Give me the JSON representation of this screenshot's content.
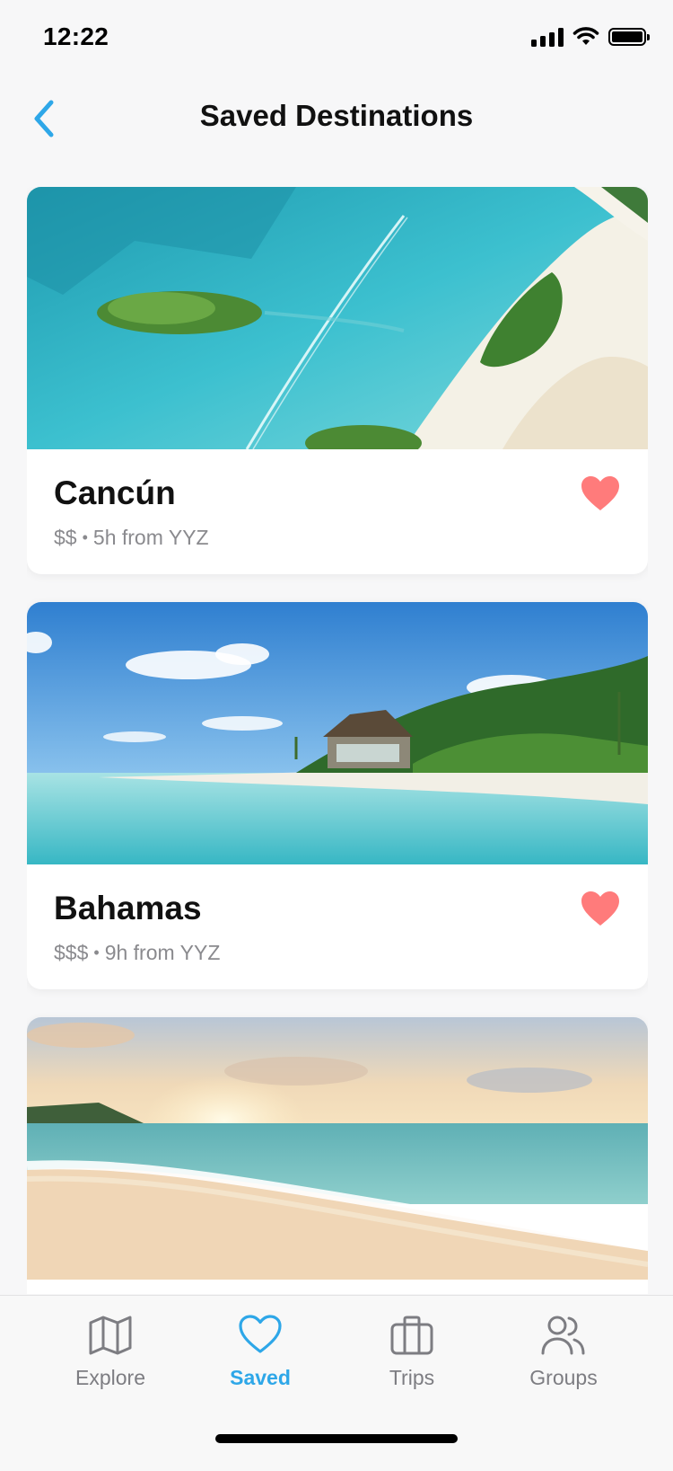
{
  "status_bar": {
    "time": "12:22",
    "icons": [
      "cellular-signal-icon",
      "wifi-icon",
      "battery-icon"
    ]
  },
  "nav": {
    "title": "Saved Destinations",
    "back_icon": "chevron-left-icon"
  },
  "destinations": [
    {
      "name": "Cancún",
      "price": "$$",
      "separator": "•",
      "travel": "5h from YYZ",
      "saved": true,
      "image": "aerial turquoise lagoon with islands"
    },
    {
      "name": "Bahamas",
      "price": "$$$",
      "separator": "•",
      "travel": "9h from YYZ",
      "saved": true,
      "image": "beach with thatched hut and palm trees"
    },
    {
      "name": "",
      "price": "",
      "separator": "",
      "travel": "",
      "saved": true,
      "image": "sunset over ocean beach"
    }
  ],
  "tabs": [
    {
      "label": "Explore",
      "icon": "map-icon",
      "active": false
    },
    {
      "label": "Saved",
      "icon": "heart-icon",
      "active": true
    },
    {
      "label": "Trips",
      "icon": "briefcase-icon",
      "active": false
    },
    {
      "label": "Groups",
      "icon": "users-icon",
      "active": false
    }
  ],
  "colors": {
    "accent": "#2ea7e8",
    "heart": "#ff7b7b",
    "muted_text": "#8a8a8e",
    "background": "#f7f7f8"
  }
}
